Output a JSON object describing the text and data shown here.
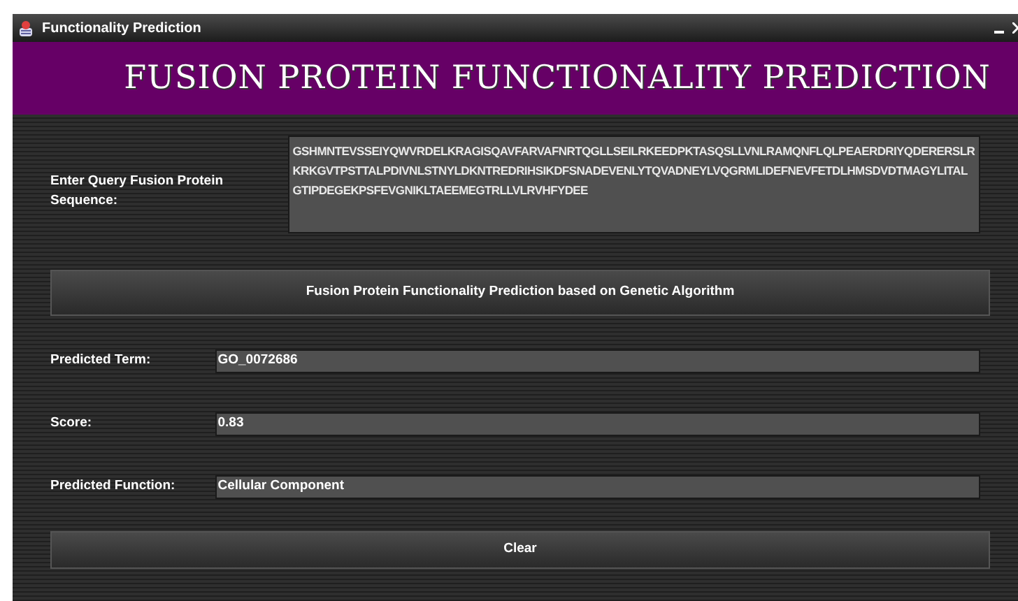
{
  "window": {
    "title": "Functionality Prediction"
  },
  "banner": {
    "title": "FUSION PROTEIN FUNCTIONALITY PREDICTION"
  },
  "query": {
    "label": "Enter Query Fusion Protein Sequence:",
    "value": "GSHMNTEVSSEIYQWVRDELKRAGISQAVFARVAFNRTQGLLSEILRKEEDPKTASQSLLVNLRAMQNFLQLPEAERDRIYQDERERSLRKRKGVTPSTTALPDIVNLSTNYLDKNTREDRIHSIKDFSNADEVENLYTQVADNEYLVQGRMLIDEFNEVFETDLHMSDVDTMAGYLITALGTIPDEGEKPSFEVGNIKLTAEEMEGTRLLVLRVHFYDEE"
  },
  "predict_button": {
    "label": "Fusion Protein Functionality Prediction based on Genetic Algorithm"
  },
  "results": [
    {
      "label": "Predicted Term:",
      "value": "GO_0072686"
    },
    {
      "label": "Score:",
      "value": "0.83"
    },
    {
      "label": "Predicted Function:",
      "value": "Cellular Component"
    }
  ],
  "clear_button": {
    "label": "Clear"
  }
}
